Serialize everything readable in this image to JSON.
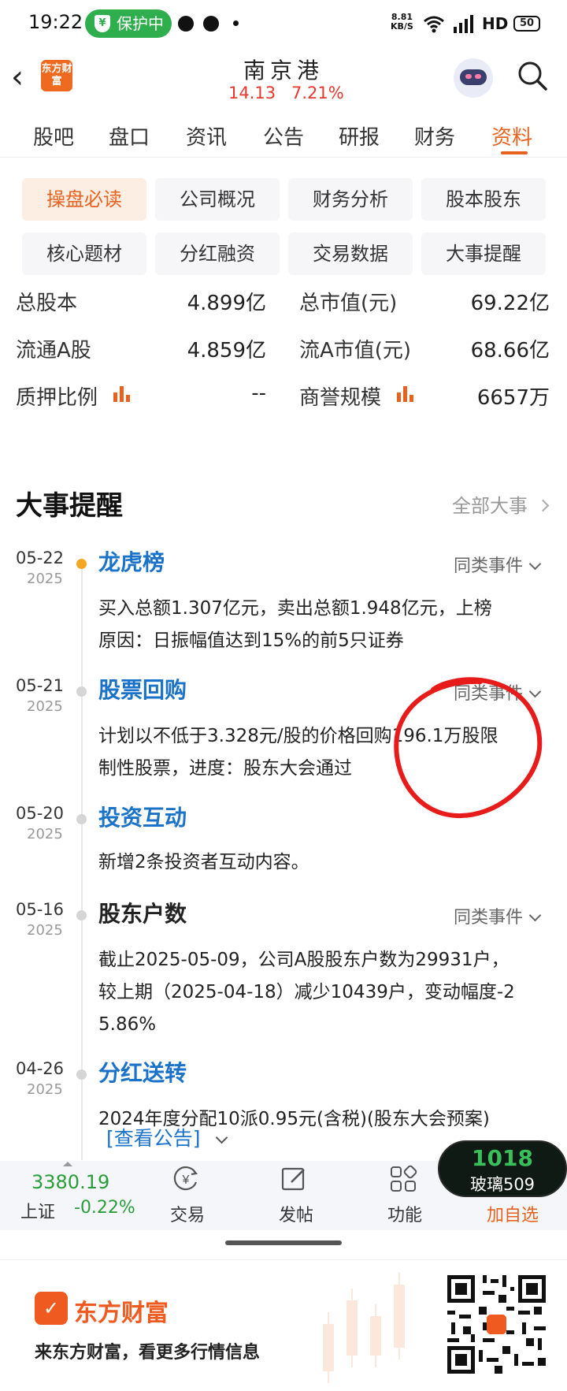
{
  "status_bar": {
    "time": "19:22",
    "protect_label": "保护中",
    "shield_glyph": "¥",
    "net_speed": "8.81",
    "net_unit": "KB/S",
    "hd": "HD",
    "battery": "50"
  },
  "header": {
    "brand_logo_text": "东方财富",
    "stock_name": "南京港",
    "price": "14.13",
    "change_pct": "7.21%"
  },
  "tabs": [
    "股吧",
    "盘口",
    "资讯",
    "公告",
    "研报",
    "财务",
    "资料"
  ],
  "active_tab": "资料",
  "sub_buttons": [
    "操盘必读",
    "公司概况",
    "财务分析",
    "股本股东",
    "核心题材",
    "分红融资",
    "交易数据",
    "大事提醒"
  ],
  "stats": [
    {
      "label": "总股本",
      "value": "4.899亿",
      "label2": "总市值(元)",
      "value2": "69.22亿"
    },
    {
      "label": "流通A股",
      "value": "4.859亿",
      "label2": "流A市值(元)",
      "value2": "68.66亿"
    },
    {
      "label": "质押比例",
      "value": "--",
      "label2": "商誉规模",
      "value2": "6657万"
    }
  ],
  "events": {
    "title": "大事提醒",
    "all_link": "全部大事",
    "same_type_label": "同类事件",
    "items": [
      {
        "date": "05-22",
        "year": "2025",
        "title": "龙虎榜",
        "body_l1": "买入总额1.307亿元，卖出总额1.948亿元，上榜",
        "body_l2": "原因：日振幅值达到15%的前5只证券",
        "body_l3": ""
      },
      {
        "date": "05-21",
        "year": "2025",
        "title": "股票回购",
        "body_l1": "计划以不低于3.328元/股的价格回购196.1万股限",
        "body_l2": "制性股票，进度：股东大会通过",
        "body_l3": ""
      },
      {
        "date": "05-20",
        "year": "2025",
        "title": "投资互动",
        "body_l1": "新增2条投资者互动内容。",
        "body_l2": "",
        "body_l3": ""
      },
      {
        "date": "05-16",
        "year": "2025",
        "title": "股东户数",
        "body_l1": "截止2025-05-09，公司A股股东户数为29931户，",
        "body_l2": "较上期（2025-04-18）减少10439户，变动幅度-2",
        "body_l3": "5.86%"
      },
      {
        "date": "04-26",
        "year": "2025",
        "title": "分红送转",
        "body_l1": "2024年度分配10派0.95元(含税)(股东大会预案)",
        "body_l2": "",
        "body_l3": ""
      }
    ],
    "notice_link": "[查看公告]"
  },
  "bottom_bar": {
    "index_value": "3380.19",
    "index_name": "上证",
    "index_change": "-0.22%",
    "trade_label": "交易",
    "post_label": "发帖",
    "function_label": "功能",
    "watch_label": "加自选",
    "bubble_number": "1018",
    "bubble_name": "玻璃509"
  },
  "footer": {
    "logo_glyph": "✓",
    "brand": "东方财富",
    "slogan": "来东方财富，看更多行情信息"
  },
  "colors": {
    "accent": "#e8621f",
    "up_red": "#e8382e",
    "down_green": "#2a9d3a",
    "link_blue": "#1a73c9"
  }
}
